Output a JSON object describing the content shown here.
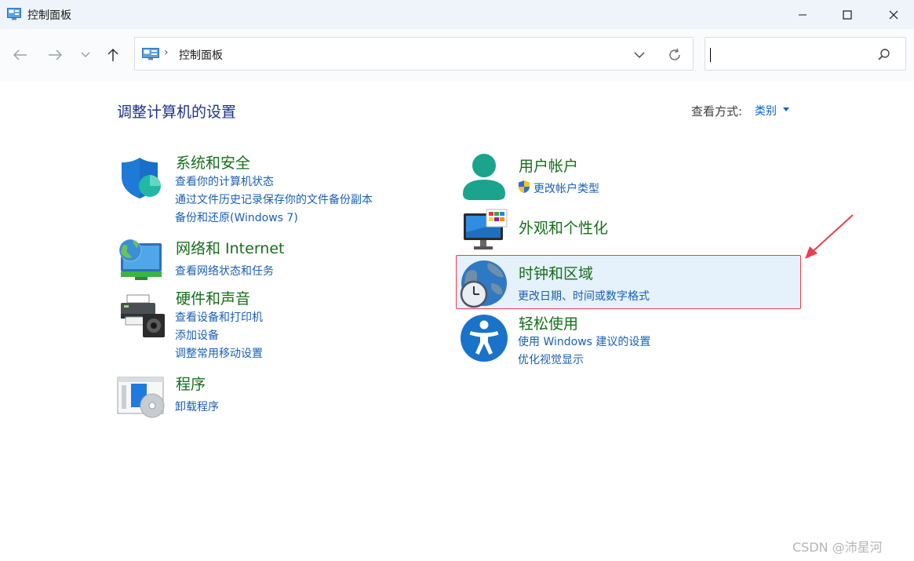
{
  "window": {
    "title": "控制面板",
    "minimize_icon": "minimize-icon",
    "maximize_icon": "maximize-icon",
    "close_icon": "close-icon"
  },
  "nav": {
    "back_icon": "arrow-left-icon",
    "forward_icon": "arrow-right-icon",
    "recent_icon": "chevron-down-icon",
    "up_icon": "arrow-up-icon",
    "address_icon": "control-panel-icon",
    "address_separator": "›",
    "address_text": "控制面板",
    "address_dropdown_icon": "chevron-down-icon",
    "refresh_icon": "refresh-icon"
  },
  "search": {
    "value": "",
    "placeholder": "",
    "icon": "search-icon"
  },
  "header": {
    "title": "调整计算机的设置",
    "view_by_label": "查看方式:",
    "view_by_value": "类别"
  },
  "categories_left": [
    {
      "title": "系统和安全",
      "icon": "shield-icon",
      "links": [
        "查看你的计算机状态",
        "通过文件历史记录保存你的文件备份副本",
        "备份和还原(Windows 7)"
      ]
    },
    {
      "title": "网络和 Internet",
      "icon": "network-globe-icon",
      "links": [
        "查看网络状态和任务"
      ]
    },
    {
      "title": "硬件和声音",
      "icon": "printer-speaker-icon",
      "links": [
        "查看设备和打印机",
        "添加设备",
        "调整常用移动设置"
      ]
    },
    {
      "title": "程序",
      "icon": "programs-disc-icon",
      "links": [
        "卸载程序"
      ]
    }
  ],
  "categories_right": [
    {
      "title": "用户帐户",
      "icon": "user-icon",
      "links": [
        "更改帐户类型"
      ],
      "link_icon": "uac-shield-icon"
    },
    {
      "title": "外观和个性化",
      "icon": "monitor-palette-icon",
      "links": []
    },
    {
      "title": "时钟和区域",
      "icon": "globe-clock-icon",
      "links": [
        "更改日期、时间或数字格式"
      ],
      "highlighted": true
    },
    {
      "title": "轻松使用",
      "icon": "accessibility-icon",
      "links": [
        "使用 Windows 建议的设置",
        "优化视觉显示"
      ]
    }
  ],
  "annotation": {
    "arrow_color": "#e8414d"
  },
  "watermark": "CSDN @沛星河",
  "colors": {
    "title_green": "#176e1b",
    "link_blue": "#1a5fb4",
    "heading_blue": "#1e3287",
    "highlight_bg": "#e5f1fb",
    "highlight_border": "#e8414d"
  }
}
